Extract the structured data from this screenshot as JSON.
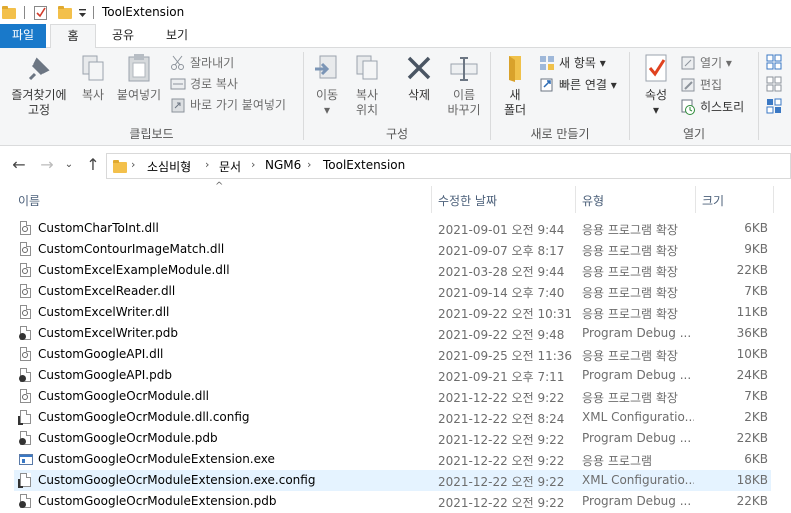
{
  "window": {
    "title": "ToolExtension"
  },
  "ribbon_tabs": [
    "파일",
    "홈",
    "공유",
    "보기"
  ],
  "ribbon": {
    "clipboard": {
      "label": "클립보드",
      "pin": [
        "즐겨찾기에",
        "고정"
      ],
      "copy": "복사",
      "paste": "붙여넣기",
      "cut": "잘라내기",
      "copy_path": "경로 복사",
      "paste_shortcut": "바로 가기 붙여넣기"
    },
    "organize": {
      "label": "구성",
      "move_to": [
        "이동",
        "위치"
      ],
      "copy_to": [
        "복사",
        "위치"
      ],
      "delete": "삭제",
      "rename": [
        "이름",
        "바꾸기"
      ]
    },
    "new": {
      "label": "새로 만들기",
      "new_folder": [
        "새",
        "폴더"
      ],
      "new_item": "새 항목",
      "easy_access": "빠른 연결"
    },
    "open": {
      "label": "열기",
      "properties": "속성",
      "open": "열기",
      "edit": "편집",
      "history": "히스토리"
    }
  },
  "address": {
    "crumbs": [
      "소심비형",
      "문서",
      "NGM6",
      "ToolExtension"
    ]
  },
  "columns": {
    "name": "이름",
    "modified": "수정한 날짜",
    "type": "유형",
    "size": "크기"
  },
  "files": [
    {
      "name": "CustomCharToInt.dll",
      "date": "2021-09-01 오전 9:44",
      "type": "응용 프로그램 확장",
      "size": "6KB",
      "icon": "dll"
    },
    {
      "name": "CustomContourImageMatch.dll",
      "date": "2021-09-07 오후 8:17",
      "type": "응용 프로그램 확장",
      "size": "9KB",
      "icon": "dll"
    },
    {
      "name": "CustomExcelExampleModule.dll",
      "date": "2021-03-28 오전 9:44",
      "type": "응용 프로그램 확장",
      "size": "22KB",
      "icon": "dll"
    },
    {
      "name": "CustomExcelReader.dll",
      "date": "2021-09-14 오후 7:40",
      "type": "응용 프로그램 확장",
      "size": "7KB",
      "icon": "dll"
    },
    {
      "name": "CustomExcelWriter.dll",
      "date": "2021-09-22 오전 10:31",
      "type": "응용 프로그램 확장",
      "size": "11KB",
      "icon": "dll"
    },
    {
      "name": "CustomExcelWriter.pdb",
      "date": "2021-09-22 오전 9:48",
      "type": "Program Debug ...",
      "size": "36KB",
      "icon": "pdb"
    },
    {
      "name": "CustomGoogleAPI.dll",
      "date": "2021-09-25 오전 11:36",
      "type": "응용 프로그램 확장",
      "size": "10KB",
      "icon": "dll"
    },
    {
      "name": "CustomGoogleAPI.pdb",
      "date": "2021-09-21 오후 7:11",
      "type": "Program Debug ...",
      "size": "24KB",
      "icon": "pdb"
    },
    {
      "name": "CustomGoogleOcrModule.dll",
      "date": "2021-12-22 오전 9:22",
      "type": "응용 프로그램 확장",
      "size": "7KB",
      "icon": "dll"
    },
    {
      "name": "CustomGoogleOcrModule.dll.config",
      "date": "2021-12-22 오전 8:24",
      "type": "XML Configuratio...",
      "size": "2KB",
      "icon": "config"
    },
    {
      "name": "CustomGoogleOcrModule.pdb",
      "date": "2021-12-22 오전 9:22",
      "type": "Program Debug ...",
      "size": "22KB",
      "icon": "pdb"
    },
    {
      "name": "CustomGoogleOcrModuleExtension.exe",
      "date": "2021-12-22 오전 9:22",
      "type": "응용 프로그램",
      "size": "6KB",
      "icon": "exe"
    },
    {
      "name": "CustomGoogleOcrModuleExtension.exe.config",
      "date": "2021-12-22 오전 9:22",
      "type": "XML Configuratio...",
      "size": "18KB",
      "icon": "config",
      "selected": true
    },
    {
      "name": "CustomGoogleOcrModuleExtension.pdb",
      "date": "2021-12-22 오전 9:22",
      "type": "Program Debug ...",
      "size": "22KB",
      "icon": "pdb"
    }
  ]
}
